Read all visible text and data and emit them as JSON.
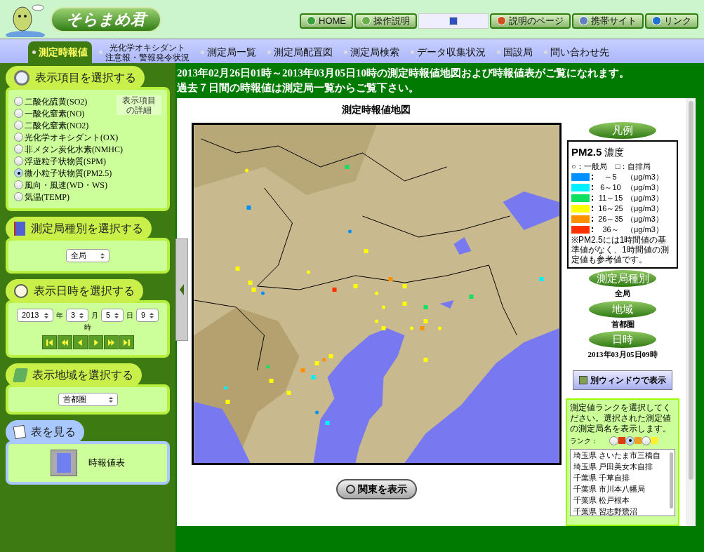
{
  "logo": {
    "title": "そらまめ君"
  },
  "top_links": [
    {
      "label": "HOME"
    },
    {
      "label": "操作説明"
    },
    {
      "kind": "help"
    },
    {
      "label": "説明のページ"
    },
    {
      "label": "携帯サイト"
    },
    {
      "label": "リンク"
    }
  ],
  "nav": [
    {
      "lines": [
        "測定時報値"
      ],
      "selected": true
    },
    {
      "lines": [
        "光化学オキシダント",
        "注意報・警報発令状況"
      ],
      "selected": false
    },
    {
      "lines": [
        "測定局一覧"
      ],
      "selected": false
    },
    {
      "lines": [
        "測定局配置図"
      ],
      "selected": false
    },
    {
      "lines": [
        "測定局検索"
      ],
      "selected": false
    },
    {
      "lines": [
        "データ収集状況"
      ],
      "selected": false
    },
    {
      "lines": [
        "国設局"
      ],
      "selected": false
    },
    {
      "lines": [
        "問い合わせ先"
      ],
      "selected": false
    }
  ],
  "item_panel": {
    "title": "表示項目を選択する",
    "detail_link": [
      "表示項目",
      "の詳細"
    ],
    "items": [
      {
        "label": "二酸化硫黄(SO2)",
        "selected": false
      },
      {
        "label": "一酸化窒素(NO)",
        "selected": false
      },
      {
        "label": "二酸化窒素(NO2)",
        "selected": false
      },
      {
        "label": "光化学オキシダント(OX)",
        "selected": false
      },
      {
        "label": "非メタン炭化水素(NMHC)",
        "selected": false
      },
      {
        "label": "浮遊粒子状物質(SPM)",
        "selected": false
      },
      {
        "label": "微小粒子状物質(PM2.5)",
        "selected": true
      },
      {
        "label": "風向・風速(WD・WS)",
        "selected": false
      },
      {
        "label": "気温(TEMP)",
        "selected": false
      }
    ]
  },
  "station_type_panel": {
    "title": "測定局種別を選択する",
    "value": "全局"
  },
  "date_panel": {
    "title": "表示日時を選択する",
    "fields": [
      {
        "value": "2013",
        "unit": "年"
      },
      {
        "value": "3",
        "unit": "月"
      },
      {
        "value": "5",
        "unit": "日"
      },
      {
        "value": "9",
        "unit": "時"
      }
    ]
  },
  "region_panel": {
    "title": "表示地域を選択する",
    "value": "首都圏"
  },
  "table_panel": {
    "title": "表を見る",
    "link": "時報値表"
  },
  "notice": [
    "2013年02月26日01時～2013年03月05日10時の測定時報値地図および時報値表がご覧になれます。",
    "過去７日間の時報値は測定局一覧からご覧下さい。"
  ],
  "map_title": "測定時報値地図",
  "map_button": "関東を表示",
  "legend": {
    "title": "凡例",
    "pollutant": "PM2.5",
    "pollutant_suffix": "濃度",
    "station_types": [
      "○：一般局",
      "□：自排局"
    ],
    "ranges": [
      {
        "color": "#0090ff",
        "range": "～5",
        "unit": "（μg/m3）"
      },
      {
        "color": "#00f0ff",
        "range": "6～10",
        "unit": "（μg/m3）"
      },
      {
        "color": "#10e060",
        "range": "11～15",
        "unit": "（μg/m3）"
      },
      {
        "color": "#ffff00",
        "range": "16～25",
        "unit": "（μg/m3）"
      },
      {
        "color": "#ff9000",
        "range": "26～35",
        "unit": "（μg/m3）"
      },
      {
        "color": "#ff3000",
        "range": "36～",
        "unit": "（μg/m3）"
      }
    ],
    "note": "※PM2.5には1時間値の基準値がなく、1時間値の測定値も参考値です。"
  },
  "info": [
    {
      "label": "測定局種別",
      "value": "全局"
    },
    {
      "label": "地域",
      "value": "首都圏"
    },
    {
      "label": "日時",
      "value": "2013年03月05日09時"
    }
  ],
  "window_button": "別ウィンドウで表示",
  "rank_panel": {
    "text": "測定値ランクを選択してください。選択された測定値の測定局名を表示します。",
    "rank_label": "ランク：",
    "ranks": [
      {
        "color": "#e03a10",
        "selected": false
      },
      {
        "color": "#f0a020",
        "selected": true
      },
      {
        "color": "#ffee30",
        "selected": false
      }
    ],
    "stations": [
      "埼玉県 さいたま市三橋自",
      "埼玉県 戸田美女木自排",
      "千葉県 千草自排",
      "千葉県 市川本八幡局",
      "千葉県 松戸根本",
      "千葉県 習志野鷺沼"
    ]
  }
}
